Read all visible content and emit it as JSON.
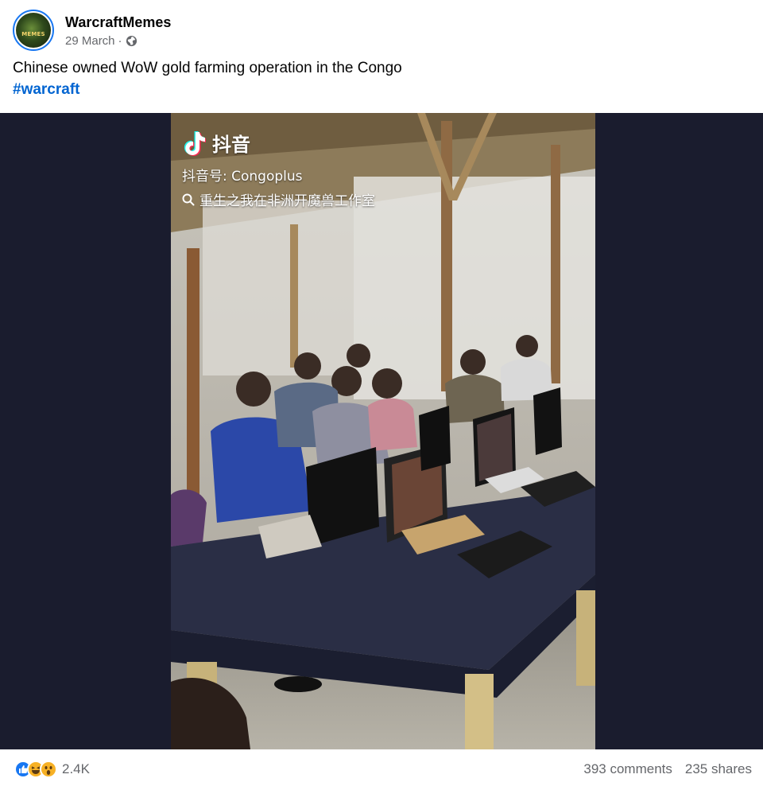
{
  "post": {
    "page_name": "WarcraftMemes",
    "date": "29 March",
    "separator": "·",
    "privacy_icon": "globe-icon",
    "avatar_text": "MEMES",
    "text": "Chinese owned WoW gold farming operation in the Congo",
    "hashtag": "#warcraft"
  },
  "video": {
    "brand": "抖音",
    "account_id": "抖音号: Congoplus",
    "search_text": "重生之我在非洲开魔兽工作室"
  },
  "footer": {
    "reaction_icons": [
      "like-icon",
      "haha-icon",
      "wow-icon"
    ],
    "reaction_count": "2.4K",
    "comments": "393 comments",
    "shares": "235 shares"
  },
  "colors": {
    "accent": "#1877f2",
    "hashtag": "#0064d1",
    "secondary_text": "#65676b",
    "media_background": "#1a1c2e"
  }
}
